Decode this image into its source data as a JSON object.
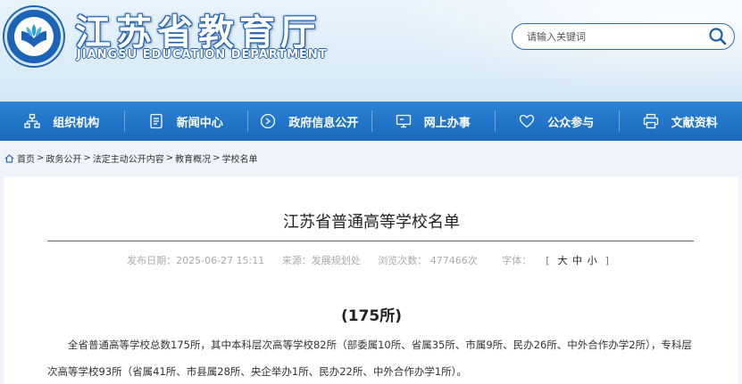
{
  "header": {
    "title": "江苏省教育厅",
    "subtitle": "JIANGSU EDUCATION DEPARTMENT",
    "search_placeholder": "请输入关键词",
    "colors": {
      "brand": "#1b63b6",
      "nav": "#1f72c8"
    }
  },
  "nav": [
    {
      "label": "组织机构",
      "icon": "org-chart-icon"
    },
    {
      "label": "新闻中心",
      "icon": "document-icon"
    },
    {
      "label": "政府信息公开",
      "icon": "disclosure-icon"
    },
    {
      "label": "网上办事",
      "icon": "monitor-icon"
    },
    {
      "label": "公众参与",
      "icon": "heart-icon"
    },
    {
      "label": "文献资料",
      "icon": "printer-icon"
    }
  ],
  "breadcrumb": [
    {
      "label": "首页"
    },
    {
      "label": "政务公开"
    },
    {
      "label": "法定主动公开内容"
    },
    {
      "label": "教育概况"
    },
    {
      "label": "学校名单"
    }
  ],
  "breadcrumb_sep": ">",
  "article": {
    "title": "江苏省普通高等学校名单",
    "publish_date": "发布日期：2025-06-27 15:11",
    "source": "来源：发展规划处",
    "views": "浏览次数：  477466次",
    "font_label": "字体：",
    "font_open": "[",
    "font_close": "]",
    "font_sizes": [
      "大",
      "中",
      "小"
    ],
    "count_heading": "(175所)",
    "paragraph": "全省普通高等学校总数175所，其中本科层次高等学校82所（部委属10所、省属35所、市属9所、民办26所、中外合作办学2所），专科层次高等学校93所（省属41所、市县属28所、央企举办1所、民办22所、中外合作办学1所）。"
  }
}
